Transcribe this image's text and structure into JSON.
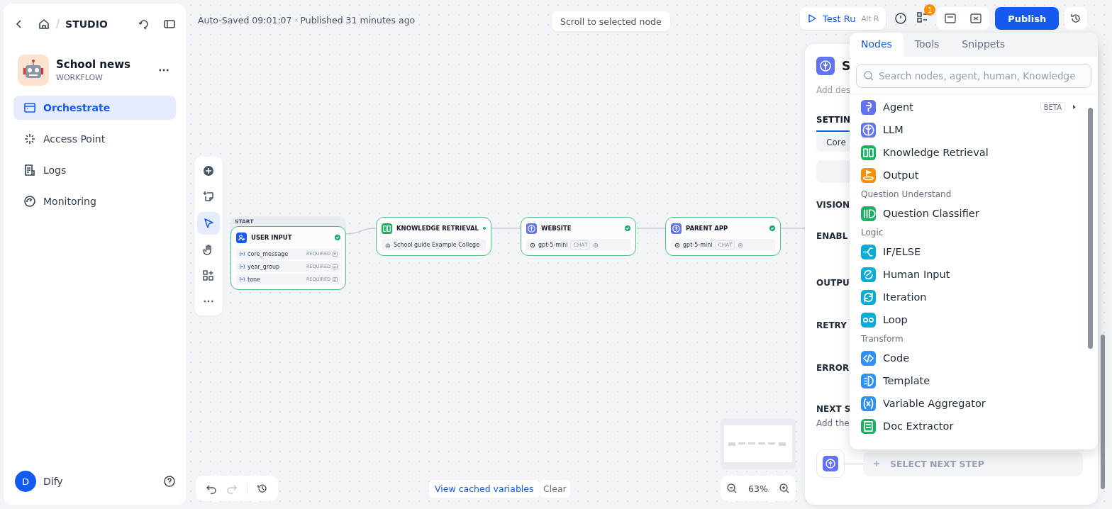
{
  "sidebar": {
    "separator": "/",
    "breadcrumb": "STUDIO",
    "app": {
      "name": "School news",
      "type": "WORKFLOW"
    },
    "nav": [
      {
        "label": "Orchestrate",
        "selected": true
      },
      {
        "label": "Access Point",
        "selected": false
      },
      {
        "label": "Logs",
        "selected": false
      },
      {
        "label": "Monitoring",
        "selected": false
      }
    ],
    "user": {
      "initial": "D",
      "name": "Dify"
    }
  },
  "header": {
    "status": "Auto-Saved 09:01:07 · Published 31 minutes ago",
    "scroll_button": "Scroll to selected node",
    "test_run": "Test Ru",
    "shortcut": "Alt R",
    "checklist_count": "1",
    "publish": "Publish"
  },
  "canvas": {
    "tools": [
      {
        "kind": "add",
        "selected": false
      },
      {
        "kind": "note",
        "selected": false
      },
      {
        "kind": "pointer",
        "selected": true
      },
      {
        "kind": "hand",
        "selected": false
      },
      {
        "kind": "organize",
        "selected": false
      },
      {
        "kind": "more",
        "selected": false
      }
    ],
    "nodes": [
      {
        "kind": "start",
        "tag": "START",
        "title": "USER INPUT",
        "color": "#155aef",
        "succeeded": true,
        "fields": [
          {
            "name": "core_message",
            "note": "REQUIRED"
          },
          {
            "name": "year_group",
            "note": "REQUIRED"
          },
          {
            "name": "tone",
            "note": "REQUIRED"
          }
        ]
      },
      {
        "kind": "knowledge",
        "title": "KNOWLEDGE RETRIEVAL",
        "color": "#16b364",
        "succeeded": true,
        "dataset": "School guide Example College"
      },
      {
        "kind": "llm",
        "title": "WEBSITE",
        "color": "#6172f3",
        "succeeded": true,
        "model": "gpt-5-mini",
        "mode": "CHAT"
      },
      {
        "kind": "llm",
        "title": "PARENT APP",
        "color": "#6172f3",
        "succeeded": true,
        "model": "gpt-5-mini",
        "mode": "CHAT"
      }
    ],
    "cache_button": "View cached variables",
    "clear_button": "Clear",
    "zoom": "63%"
  },
  "panel": {
    "title": "S",
    "description_placeholder": "Add des",
    "tab": {
      "label": "SETTIN",
      "selected": true
    },
    "chip": "Core",
    "sections": [
      "VISION",
      "ENABL",
      "OUTPU",
      "RETRY",
      "ERROR"
    ],
    "next_step": {
      "title": "NEXT S",
      "hint": "Add the",
      "button": "SELECT NEXT STEP"
    }
  },
  "block_picker": {
    "tabs": [
      {
        "label": "Nodes",
        "selected": true
      },
      {
        "label": "Tools",
        "selected": false
      },
      {
        "label": "Snippets",
        "selected": false
      }
    ],
    "search": {
      "placeholder": "Search nodes, agent, human, Knowledge"
    },
    "entries": [
      {
        "kind": "node",
        "label": "Agent",
        "badge": "BETA",
        "color": "#6172f3"
      },
      {
        "kind": "node",
        "label": "LLM",
        "color": "#6172f3"
      },
      {
        "kind": "node",
        "label": "Knowledge Retrieval",
        "color": "#16b364"
      },
      {
        "kind": "node",
        "label": "Output",
        "color": "#f79009"
      },
      {
        "kind": "heading",
        "label": "Question Understand"
      },
      {
        "kind": "node",
        "label": "Question Classifier",
        "color": "#16b364"
      },
      {
        "kind": "heading",
        "label": "Logic"
      },
      {
        "kind": "node",
        "label": "IF/ELSE",
        "color": "#06aed4"
      },
      {
        "kind": "node",
        "label": "Human Input",
        "color": "#06aed4"
      },
      {
        "kind": "node",
        "label": "Iteration",
        "color": "#06aed4"
      },
      {
        "kind": "node",
        "label": "Loop",
        "color": "#06aed4"
      },
      {
        "kind": "heading",
        "label": "Transform"
      },
      {
        "kind": "node",
        "label": "Code",
        "color": "#2e90fa"
      },
      {
        "kind": "node",
        "label": "Template",
        "color": "#2e90fa"
      },
      {
        "kind": "node",
        "label": "Variable Aggregator",
        "color": "#2e90fa"
      },
      {
        "kind": "node",
        "label": "Doc Extractor",
        "color": "#16b364"
      }
    ]
  }
}
